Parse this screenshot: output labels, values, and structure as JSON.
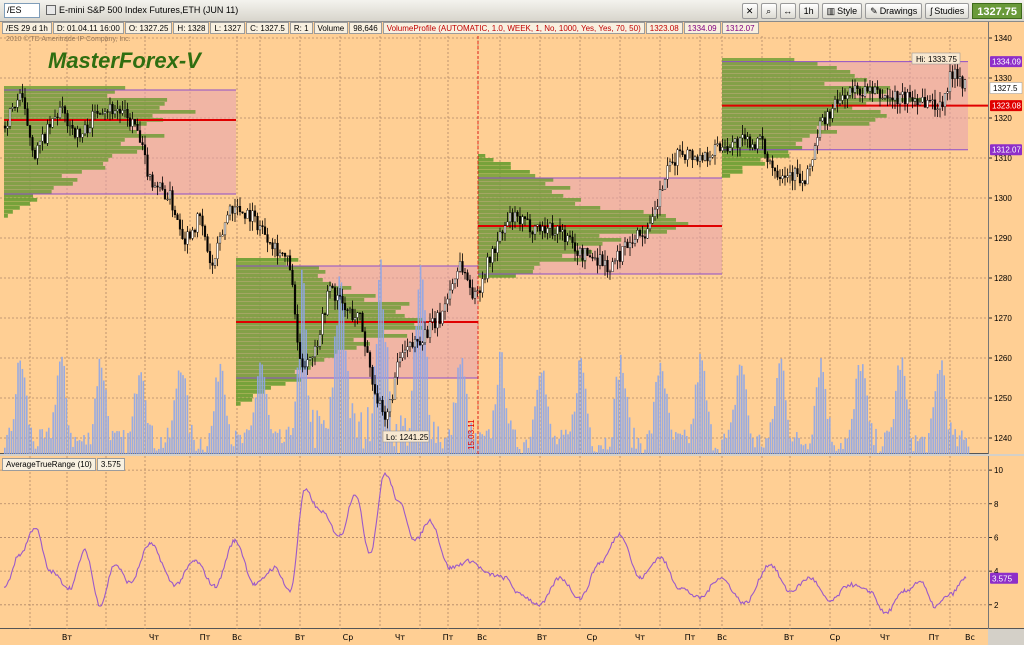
{
  "toolbar": {
    "symbol": "/ES",
    "description": "E-mini S&P 500 Index Futures,ETH (JUN 11)",
    "interval": "1h",
    "style_label": "Style",
    "drawings_label": "Drawings",
    "studies_label": "Studies",
    "last_price": "1327.75"
  },
  "info_bar": {
    "symbol_tf": "/ES 29 d 1h",
    "date": "D: 01.04.11 16:00",
    "open": "O: 1327.25",
    "high": "H: 1328",
    "low": "L: 1327",
    "close": "C: 1327.5",
    "range": "R: 1",
    "volume_label": "Volume",
    "volume_value": "98,646",
    "vp_study": "VolumeProfile (AUTOMATIC, 1.0, WEEK, 1, No, 1000, Yes, Yes, 70, 50)",
    "vp_poc": "1323.08",
    "vp_high": "1334.09",
    "vp_low": "1312.07"
  },
  "copyright": "2010 © TD Ameritrade IP Company, Inc.",
  "brand": "MasterForex-V",
  "annotations": {
    "high": "Hi: 1333.75",
    "low": "Lo: 1241.25",
    "date_marker": "15.03.11",
    "current_price": "1327.5"
  },
  "price_axis": {
    "ticks": [
      "1340",
      "1330",
      "1320",
      "1310",
      "1300",
      "1290",
      "1280",
      "1270",
      "1260",
      "1250",
      "1240"
    ],
    "labels": [
      {
        "text": "1334.09",
        "color": "#8e2ec9"
      },
      {
        "text": "1323.08",
        "color": "#e00000"
      },
      {
        "text": "1312.07",
        "color": "#8e2ec9"
      }
    ]
  },
  "atr": {
    "title": "AverageTrueRange (10)",
    "value": "3.575",
    "axis_ticks": [
      "10",
      "8",
      "6",
      "4",
      "2"
    ],
    "line_color": "#9b59c9"
  },
  "time_axis": {
    "labels": [
      "Вт",
      "Чт",
      "Пт",
      "Вс",
      "Вт",
      "Ср",
      "Чт",
      "Пт",
      "Вс",
      "Вт",
      "Ср",
      "Чт",
      "Пт",
      "Вс",
      "Вт",
      "Ср",
      "Чт",
      "Пт",
      "Вс"
    ]
  },
  "colors": {
    "background": "#ffcf94",
    "candle_up": "#ffffff",
    "candle_down": "#000000",
    "volume": "#8ea6e8",
    "profile_green": "#5f9a2a",
    "value_area_pink": "#e6a0b0",
    "poc_red": "#e00000",
    "grid": "#b08868"
  }
}
